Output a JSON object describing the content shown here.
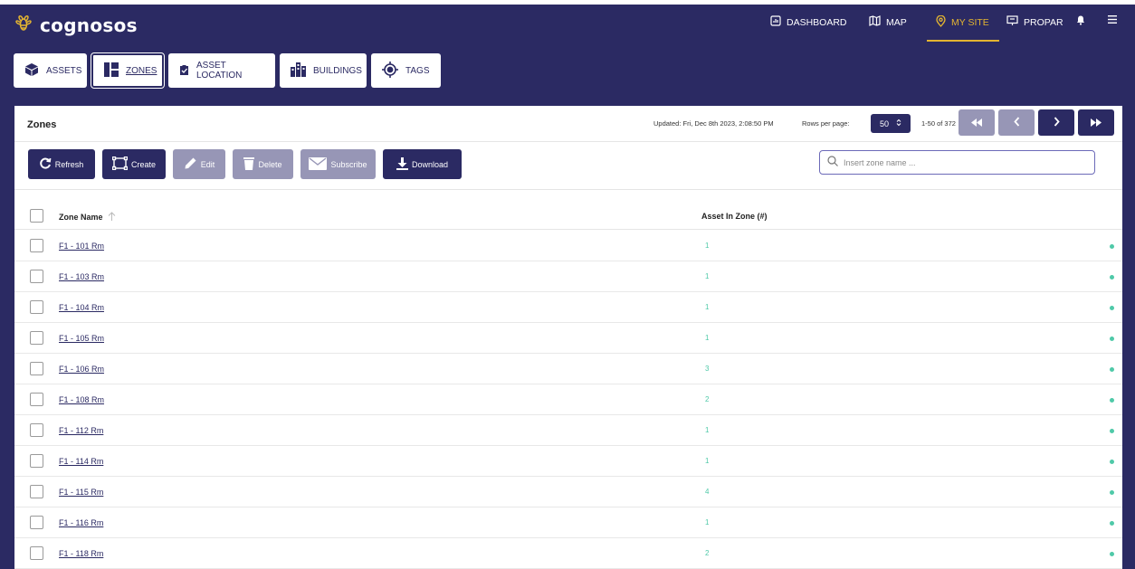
{
  "colors": {
    "navy": "#2b2a63",
    "accent": "#e3b431",
    "disabled": "#9796b6",
    "teal": "#4fc9a8"
  },
  "brand": {
    "name": "cognosos",
    "icon": "bee-logo-icon"
  },
  "topnav": {
    "dashboard": "DASHBOARD",
    "map": "MAP",
    "mysite": "MY SITE",
    "propar": "PROPAR"
  },
  "tabs": {
    "assets": "ASSETS",
    "zones": "ZONES",
    "asset_location": "ASSET LOCATION",
    "buildings": "BUILDINGS",
    "tags": "TAGS"
  },
  "panel": {
    "title": "Zones",
    "updated": "Updated: Fri, Dec 8th 2023, 2:08:50 PM",
    "rows_label": "Rows per page:",
    "rows_value": "50",
    "range": "1-50 of 372"
  },
  "toolbar": {
    "refresh": "Refresh",
    "create": "Create",
    "edit": "Edit",
    "delete": "Delete",
    "subscribe": "Subscribe",
    "download": "Download"
  },
  "search": {
    "placeholder": "Insert zone name ..."
  },
  "table": {
    "col_name": "Zone Name",
    "col_count": "Asset In Zone (#)",
    "rows": [
      {
        "name": "F1 - 101 Rm",
        "count": "1"
      },
      {
        "name": "F1 - 103 Rm",
        "count": "1"
      },
      {
        "name": "F1 - 104 Rm",
        "count": "1"
      },
      {
        "name": "F1 - 105 Rm",
        "count": "1"
      },
      {
        "name": "F1 - 106 Rm",
        "count": "3"
      },
      {
        "name": "F1 - 108 Rm",
        "count": "2"
      },
      {
        "name": "F1 - 112 Rm",
        "count": "1"
      },
      {
        "name": "F1 - 114 Rm",
        "count": "1"
      },
      {
        "name": "F1 - 115 Rm",
        "count": "4"
      },
      {
        "name": "F1 - 116 Rm",
        "count": "1"
      },
      {
        "name": "F1 - 118 Rm",
        "count": "2"
      }
    ]
  }
}
